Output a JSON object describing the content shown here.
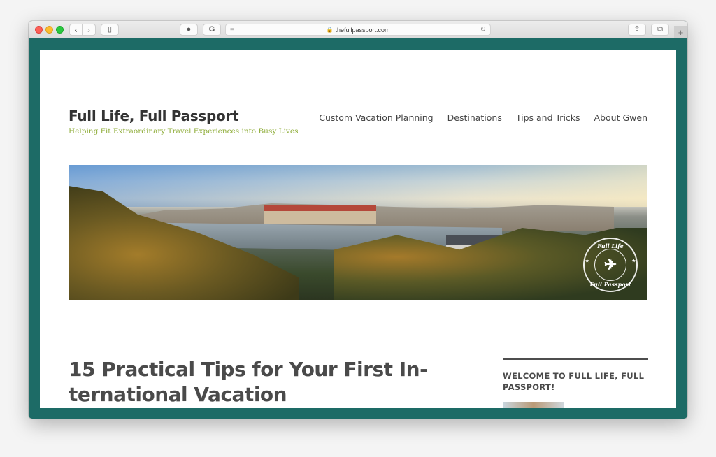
{
  "browser": {
    "url": "thefullpassport.com",
    "new_tab_label": "+",
    "icons": {
      "back": "‹",
      "forward": "›",
      "sidebar": "▯",
      "extension_1": "●",
      "extension_2": "G",
      "reader": "≡",
      "lock": "🔒",
      "reload": "↻",
      "share": "⇪",
      "tabs": "⧉"
    }
  },
  "site": {
    "title": "Full Life, Full Passport",
    "tagline": "Helping Fit Extraordinary Travel Experiences into Busy Lives",
    "brand_color": "#1d6b66",
    "tagline_color": "#8fad3a"
  },
  "nav": {
    "items": [
      {
        "label": "Custom Vacation Planning"
      },
      {
        "label": "Destinations"
      },
      {
        "label": "Tips and Tricks"
      },
      {
        "label": "About Gwen"
      }
    ]
  },
  "hero": {
    "stamp_top": "Full Life",
    "stamp_bottom": "Full Passport",
    "stamp_icon": "✈",
    "stars": "★"
  },
  "post": {
    "title": "15 Practical Tips for Your First In-ternational Vacation"
  },
  "sidebar": {
    "widget_title": "WELCOME TO FULL LIFE, FULL PASSPORT!"
  }
}
